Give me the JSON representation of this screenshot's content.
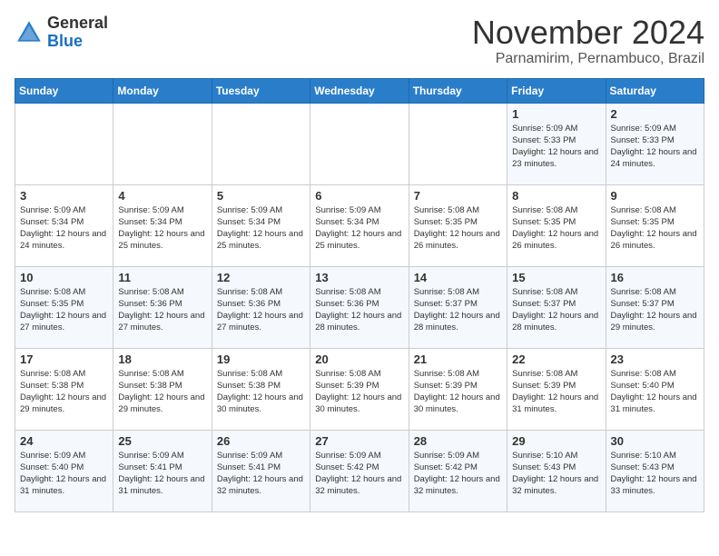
{
  "header": {
    "logo_line1": "General",
    "logo_line2": "Blue",
    "month_year": "November 2024",
    "location": "Parnamirim, Pernambuco, Brazil"
  },
  "weekdays": [
    "Sunday",
    "Monday",
    "Tuesday",
    "Wednesday",
    "Thursday",
    "Friday",
    "Saturday"
  ],
  "weeks": [
    [
      {
        "day": "",
        "info": ""
      },
      {
        "day": "",
        "info": ""
      },
      {
        "day": "",
        "info": ""
      },
      {
        "day": "",
        "info": ""
      },
      {
        "day": "",
        "info": ""
      },
      {
        "day": "1",
        "info": "Sunrise: 5:09 AM\nSunset: 5:33 PM\nDaylight: 12 hours and 23 minutes."
      },
      {
        "day": "2",
        "info": "Sunrise: 5:09 AM\nSunset: 5:33 PM\nDaylight: 12 hours and 24 minutes."
      }
    ],
    [
      {
        "day": "3",
        "info": "Sunrise: 5:09 AM\nSunset: 5:34 PM\nDaylight: 12 hours and 24 minutes."
      },
      {
        "day": "4",
        "info": "Sunrise: 5:09 AM\nSunset: 5:34 PM\nDaylight: 12 hours and 25 minutes."
      },
      {
        "day": "5",
        "info": "Sunrise: 5:09 AM\nSunset: 5:34 PM\nDaylight: 12 hours and 25 minutes."
      },
      {
        "day": "6",
        "info": "Sunrise: 5:09 AM\nSunset: 5:34 PM\nDaylight: 12 hours and 25 minutes."
      },
      {
        "day": "7",
        "info": "Sunrise: 5:08 AM\nSunset: 5:35 PM\nDaylight: 12 hours and 26 minutes."
      },
      {
        "day": "8",
        "info": "Sunrise: 5:08 AM\nSunset: 5:35 PM\nDaylight: 12 hours and 26 minutes."
      },
      {
        "day": "9",
        "info": "Sunrise: 5:08 AM\nSunset: 5:35 PM\nDaylight: 12 hours and 26 minutes."
      }
    ],
    [
      {
        "day": "10",
        "info": "Sunrise: 5:08 AM\nSunset: 5:35 PM\nDaylight: 12 hours and 27 minutes."
      },
      {
        "day": "11",
        "info": "Sunrise: 5:08 AM\nSunset: 5:36 PM\nDaylight: 12 hours and 27 minutes."
      },
      {
        "day": "12",
        "info": "Sunrise: 5:08 AM\nSunset: 5:36 PM\nDaylight: 12 hours and 27 minutes."
      },
      {
        "day": "13",
        "info": "Sunrise: 5:08 AM\nSunset: 5:36 PM\nDaylight: 12 hours and 28 minutes."
      },
      {
        "day": "14",
        "info": "Sunrise: 5:08 AM\nSunset: 5:37 PM\nDaylight: 12 hours and 28 minutes."
      },
      {
        "day": "15",
        "info": "Sunrise: 5:08 AM\nSunset: 5:37 PM\nDaylight: 12 hours and 28 minutes."
      },
      {
        "day": "16",
        "info": "Sunrise: 5:08 AM\nSunset: 5:37 PM\nDaylight: 12 hours and 29 minutes."
      }
    ],
    [
      {
        "day": "17",
        "info": "Sunrise: 5:08 AM\nSunset: 5:38 PM\nDaylight: 12 hours and 29 minutes."
      },
      {
        "day": "18",
        "info": "Sunrise: 5:08 AM\nSunset: 5:38 PM\nDaylight: 12 hours and 29 minutes."
      },
      {
        "day": "19",
        "info": "Sunrise: 5:08 AM\nSunset: 5:38 PM\nDaylight: 12 hours and 30 minutes."
      },
      {
        "day": "20",
        "info": "Sunrise: 5:08 AM\nSunset: 5:39 PM\nDaylight: 12 hours and 30 minutes."
      },
      {
        "day": "21",
        "info": "Sunrise: 5:08 AM\nSunset: 5:39 PM\nDaylight: 12 hours and 30 minutes."
      },
      {
        "day": "22",
        "info": "Sunrise: 5:08 AM\nSunset: 5:39 PM\nDaylight: 12 hours and 31 minutes."
      },
      {
        "day": "23",
        "info": "Sunrise: 5:08 AM\nSunset: 5:40 PM\nDaylight: 12 hours and 31 minutes."
      }
    ],
    [
      {
        "day": "24",
        "info": "Sunrise: 5:09 AM\nSunset: 5:40 PM\nDaylight: 12 hours and 31 minutes."
      },
      {
        "day": "25",
        "info": "Sunrise: 5:09 AM\nSunset: 5:41 PM\nDaylight: 12 hours and 31 minutes."
      },
      {
        "day": "26",
        "info": "Sunrise: 5:09 AM\nSunset: 5:41 PM\nDaylight: 12 hours and 32 minutes."
      },
      {
        "day": "27",
        "info": "Sunrise: 5:09 AM\nSunset: 5:42 PM\nDaylight: 12 hours and 32 minutes."
      },
      {
        "day": "28",
        "info": "Sunrise: 5:09 AM\nSunset: 5:42 PM\nDaylight: 12 hours and 32 minutes."
      },
      {
        "day": "29",
        "info": "Sunrise: 5:10 AM\nSunset: 5:43 PM\nDaylight: 12 hours and 32 minutes."
      },
      {
        "day": "30",
        "info": "Sunrise: 5:10 AM\nSunset: 5:43 PM\nDaylight: 12 hours and 33 minutes."
      }
    ]
  ]
}
